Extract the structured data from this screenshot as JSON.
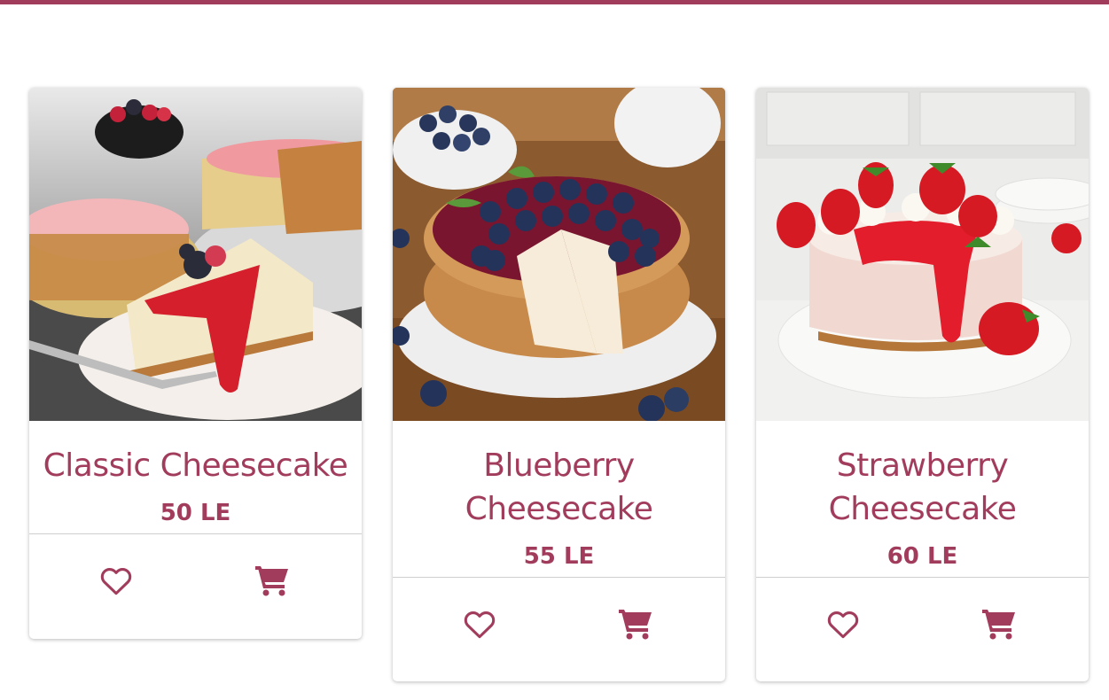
{
  "colors": {
    "accent": "#a23c5c",
    "divider": "#cfcfcf"
  },
  "products": [
    {
      "name": "Classic Cheesecake",
      "price": "50 LE",
      "image": "classic-cheesecake-with-berries",
      "icons": [
        "heart-outline-icon",
        "shopping-cart-icon"
      ]
    },
    {
      "name": "Blueberry Cheesecake",
      "price": "55 LE",
      "image": "blueberry-cheesecake",
      "icons": [
        "heart-outline-icon",
        "shopping-cart-icon"
      ]
    },
    {
      "name": "Strawberry Cheesecake",
      "price": "60 LE",
      "image": "strawberry-cheesecake",
      "icons": [
        "heart-outline-icon",
        "shopping-cart-icon"
      ]
    }
  ]
}
